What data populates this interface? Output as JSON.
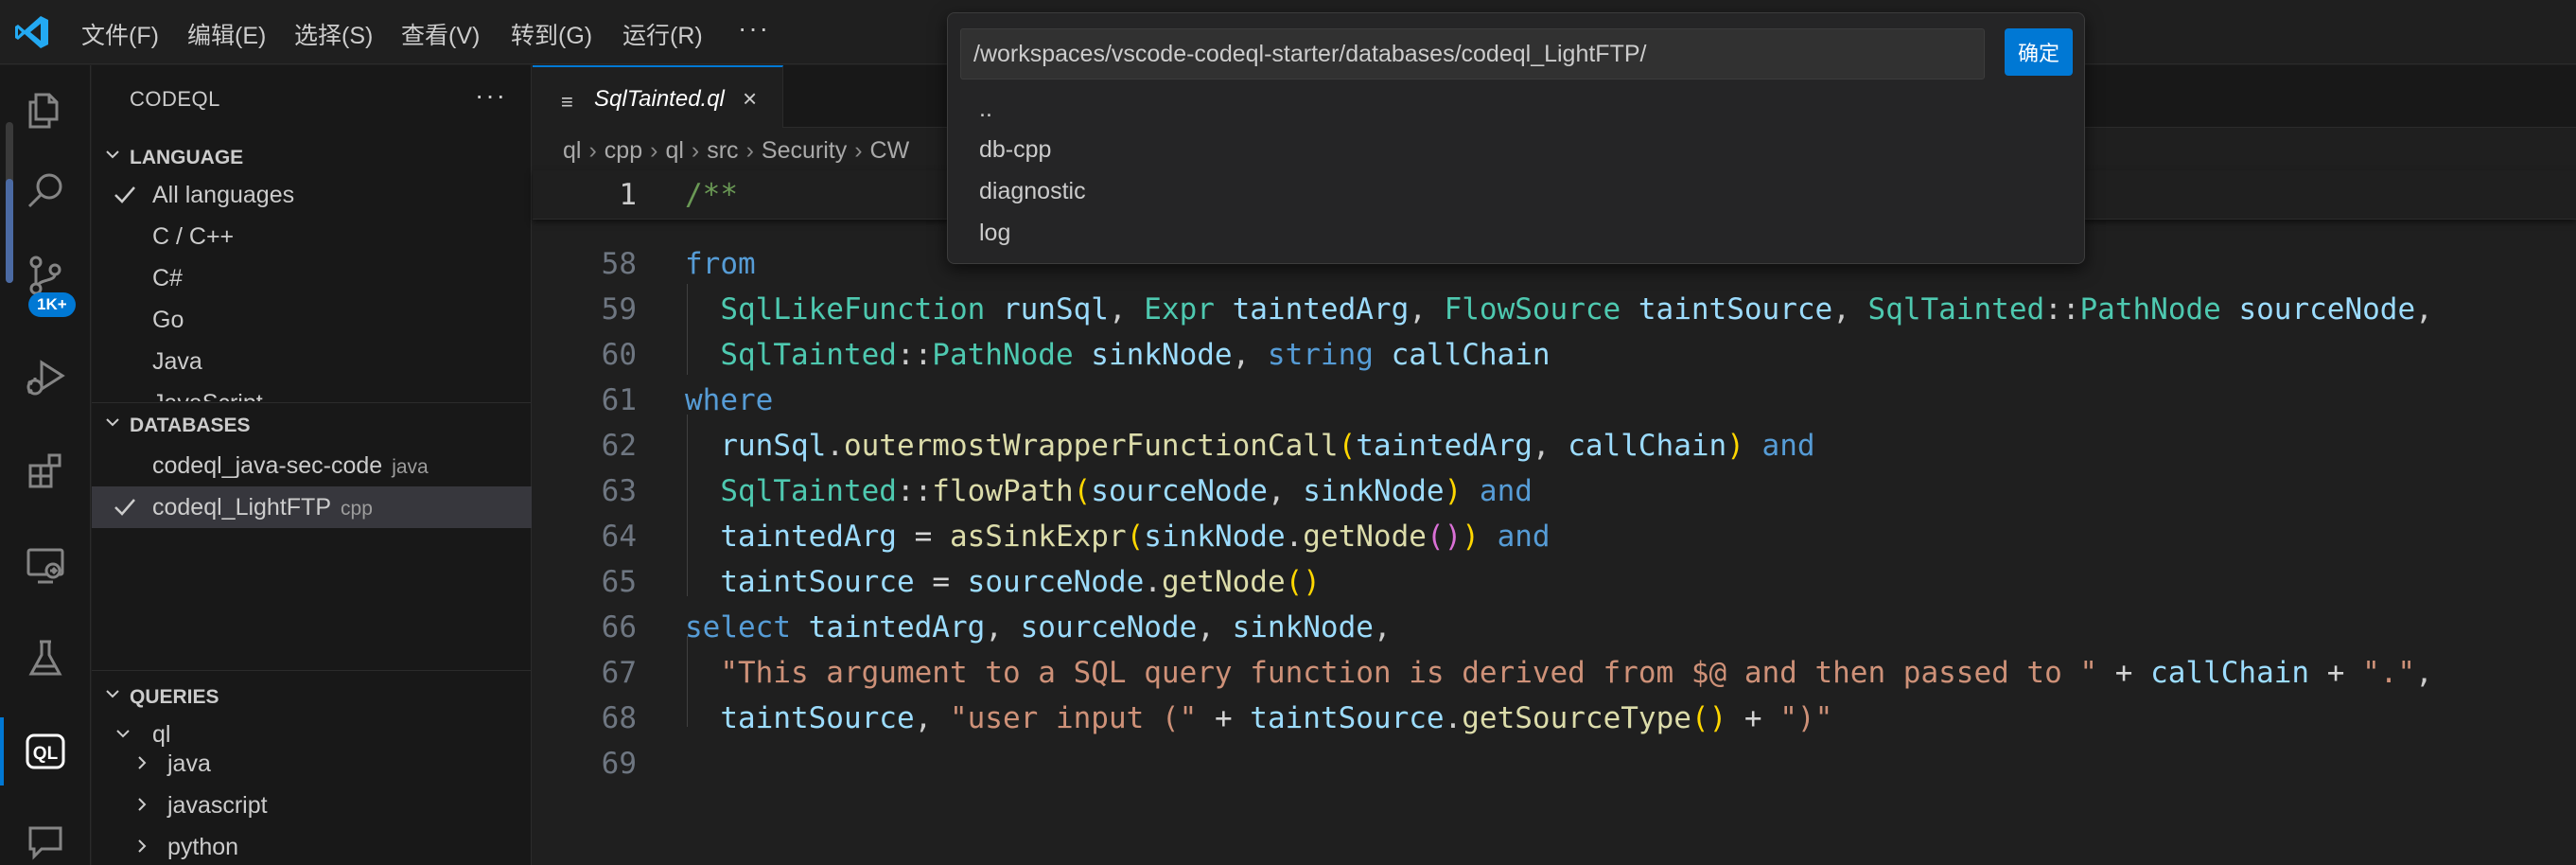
{
  "menubar": {
    "items": [
      "文件(F)",
      "编辑(E)",
      "选择(S)",
      "查看(V)",
      "转到(G)",
      "运行(R)"
    ],
    "more": "···"
  },
  "activity": {
    "source_control_badge": "1K+",
    "icons": [
      "explorer-icon",
      "search-icon",
      "source-control-icon",
      "run-debug-icon",
      "extensions-icon",
      "remote-explorer-icon",
      "testing-icon",
      "codeql-icon",
      "chat-icon"
    ]
  },
  "sidebar": {
    "title": "CODEQL",
    "more": "···",
    "language": {
      "header": "LANGUAGE",
      "items": [
        "All languages",
        "C / C++",
        "C#",
        "Go",
        "Java",
        "JavaScript"
      ]
    },
    "databases": {
      "header": "DATABASES",
      "items": [
        {
          "name": "codeql_java-sec-code",
          "lang": "java"
        },
        {
          "name": "codeql_LightFTP",
          "lang": "cpp"
        }
      ]
    },
    "queries": {
      "header": "QUERIES",
      "root": "ql",
      "items": [
        "java",
        "javascript",
        "python"
      ]
    }
  },
  "editor": {
    "tab": {
      "name": "SqlTainted.ql",
      "icon": "≡",
      "close": "×"
    },
    "breadcrumb": [
      "ql",
      "cpp",
      "ql",
      "src",
      "Security",
      "CW"
    ],
    "sticky_line": {
      "number": "1",
      "text": "/**"
    },
    "line_numbers": [
      "58",
      "59",
      "60",
      "61",
      "62",
      "63",
      "64",
      "65",
      "66",
      "67",
      "68",
      "69"
    ]
  },
  "quickpick": {
    "input_value": "/workspaces/vscode-codeql-starter/databases/codeql_LightFTP/",
    "ok_label": "确定",
    "items": [
      "..",
      "db-cpp",
      "diagnostic",
      "log"
    ]
  },
  "colors": {
    "accent": "#0078d4",
    "editor_bg": "#1f1f1f",
    "sidebar_bg": "#181818",
    "keyword": "#569cd6",
    "type": "#4ec9b0",
    "function": "#dcdcaa",
    "variable": "#9cdcfe",
    "string": "#ce9178",
    "comment": "#6a9955"
  }
}
